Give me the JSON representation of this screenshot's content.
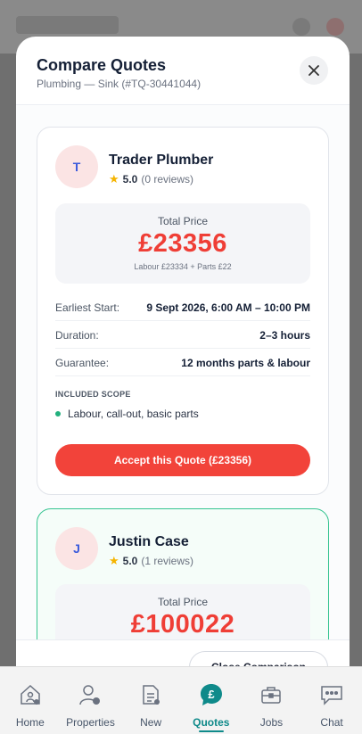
{
  "background": {
    "title": "Instaquote"
  },
  "modal": {
    "title": "Compare Quotes",
    "subtitle": "Plumbing — Sink (#TQ-30441044)"
  },
  "quotes": [
    {
      "initial": "T",
      "name": "Trader Plumber",
      "rating": "5.0",
      "reviews": "(0 reviews)",
      "price_label": "Total Price",
      "price": "£23356",
      "breakdown": "Labour £23334 + Parts £22",
      "details": [
        {
          "label": "Earliest Start:",
          "value": "9 Sept 2026, 6:00 AM – 10:00 PM"
        },
        {
          "label": "Duration:",
          "value": "2–3 hours"
        },
        {
          "label": "Guarantee:",
          "value": "12 months parts & labour"
        }
      ],
      "scope_heading": "INCLUDED SCOPE",
      "scope_items": [
        "Labour, call-out, basic parts"
      ],
      "accept_label": "Accept this Quote (£23356)"
    },
    {
      "initial": "J",
      "name": "Justin Case",
      "rating": "5.0",
      "reviews": "(1 reviews)",
      "price_label": "Total Price",
      "price": "£100022"
    }
  ],
  "footer": {
    "button_label": "Close Comparison"
  },
  "nav": [
    {
      "label": "Home",
      "icon": "home-icon"
    },
    {
      "label": "Properties",
      "icon": "person-icon"
    },
    {
      "label": "New",
      "icon": "document-icon"
    },
    {
      "label": "Quotes",
      "icon": "pound-icon",
      "active": true
    },
    {
      "label": "Jobs",
      "icon": "briefcase-icon"
    },
    {
      "label": "Chat",
      "icon": "chat-icon"
    }
  ],
  "colors": {
    "accent": "#f2433a",
    "active_nav": "#0f8a8a",
    "highlight_border": "#35c490"
  }
}
